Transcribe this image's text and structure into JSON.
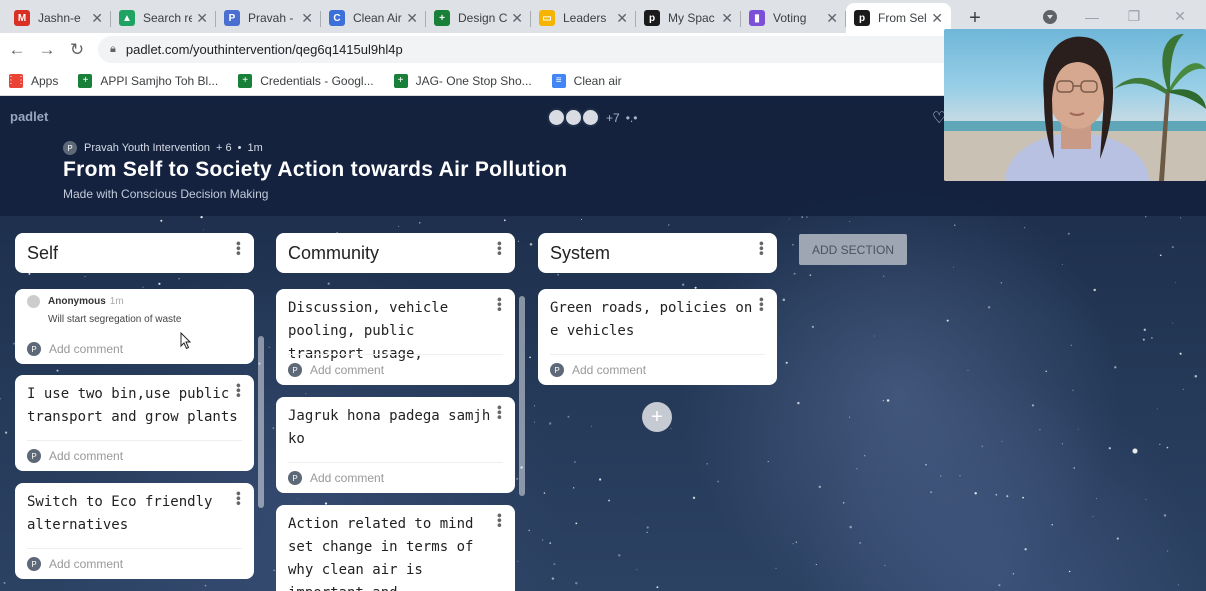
{
  "tabs": [
    {
      "title": "Jashn-e",
      "icon": "gmail-icon",
      "color": "#d93025",
      "glyph": "M"
    },
    {
      "title": "Search re",
      "icon": "drive-icon",
      "color": "#1ea362",
      "glyph": "▲"
    },
    {
      "title": "Pravah -",
      "icon": "forms-icon",
      "color": "#4a6fd1",
      "glyph": "P"
    },
    {
      "title": "Clean Air",
      "icon": "chrome-icon",
      "color": "#3d6fd8",
      "glyph": "C"
    },
    {
      "title": "Design C",
      "icon": "sheets-icon",
      "color": "#188038",
      "glyph": "+"
    },
    {
      "title": "Leaders",
      "icon": "slides-icon",
      "color": "#f4b400",
      "glyph": "▭"
    },
    {
      "title": "My Spac",
      "icon": "padlet-icon",
      "color": "#1b1b1b",
      "glyph": "p"
    },
    {
      "title": "Voting",
      "icon": "chart-icon",
      "color": "#7b4fd8",
      "glyph": "▮"
    },
    {
      "title": "From Sel",
      "icon": "padlet-icon",
      "color": "#1b1b1b",
      "glyph": "p"
    }
  ],
  "address": {
    "url": "padlet.com/youthintervention/qeg6q1415ul9hl4p"
  },
  "bookmarks": [
    {
      "label": "Apps",
      "icon": "apps-grid-icon",
      "color": "#ea4335",
      "glyph": "⋮⋮"
    },
    {
      "label": "APPI Samjho Toh Bl...",
      "icon": "sheets-icon",
      "color": "#188038",
      "glyph": "+"
    },
    {
      "label": "Credentials - Googl...",
      "icon": "sheets-icon",
      "color": "#188038",
      "glyph": "+"
    },
    {
      "label": "JAG- One Stop Sho...",
      "icon": "sheets-icon",
      "color": "#188038",
      "glyph": "+"
    },
    {
      "label": "Clean air",
      "icon": "docs-icon",
      "color": "#4285f4",
      "glyph": "≡"
    }
  ],
  "padlet": {
    "logo": "padlet",
    "collaborators_more": "+7",
    "author": "Pravah Youth Intervention",
    "author_initial": "P",
    "contributors": "+ 6",
    "time": "1m",
    "title": "From Self to Society Action towards Air Pollution",
    "subtitle": "Made with Conscious Decision Making",
    "add_section": "ADD SECTION",
    "add_comment": "Add comment"
  },
  "columns": [
    {
      "name": "Self"
    },
    {
      "name": "Community"
    },
    {
      "name": "System"
    }
  ],
  "posts": {
    "self": [
      {
        "author": "Anonymous",
        "time": "1m",
        "text": "Will start segregation of waste"
      },
      {
        "text": "I use two bin,use public transport and grow plants"
      },
      {
        "text": "Switch to Eco friendly alternatives"
      }
    ],
    "community": [
      {
        "text": "Discussion, vehicle pooling, public transport usage,"
      },
      {
        "text": "Jagruk hona padega samjh ko"
      },
      {
        "text": "Action related to mind set change in terms of why clean air is important and"
      }
    ],
    "system": [
      {
        "text": "Green roads, policies on e vehicles"
      }
    ]
  }
}
